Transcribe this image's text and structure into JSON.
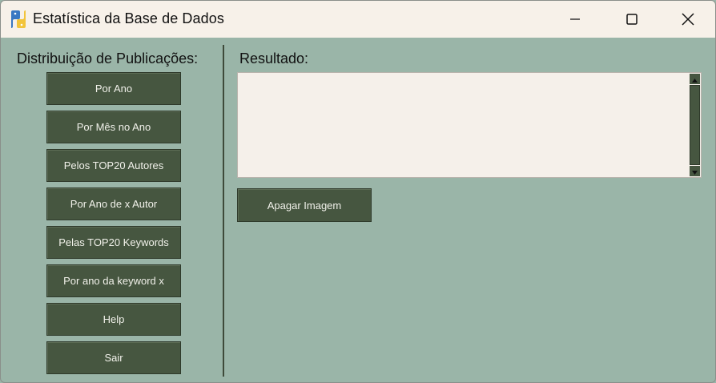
{
  "window": {
    "title": "Estatística da Base de Dados",
    "controls": {
      "minimize_icon": "minimize-icon",
      "maximize_icon": "maximize-icon",
      "close_icon": "close-icon"
    }
  },
  "left_panel": {
    "title": "Distribuição de Publicações:",
    "buttons": [
      "Por Ano",
      "Por Mês no Ano",
      "Pelos TOP20 Autores",
      "Por Ano de x Autor",
      "Pelas TOP20 Keywords",
      "Por ano da keyword x",
      "Help",
      "Sair"
    ]
  },
  "right_panel": {
    "title": "Resultado:",
    "result_text": "",
    "clear_button": "Apagar Imagem"
  },
  "colors": {
    "background": "#9ab5a8",
    "titlebar": "#f7f1e9",
    "button": "#465640",
    "button_text": "#f1f1ea",
    "result_bg": "#f5f0ea"
  }
}
